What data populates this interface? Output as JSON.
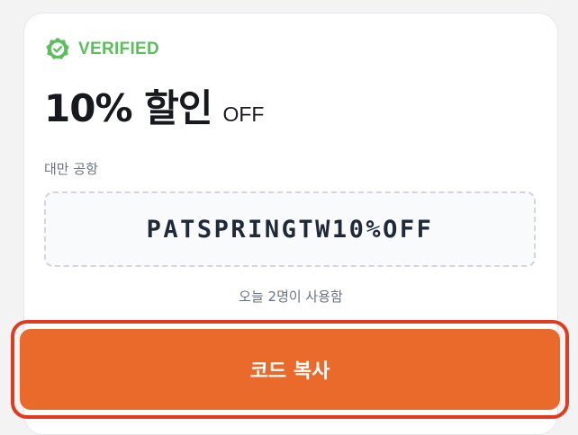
{
  "coupon": {
    "verified_label": "VERIFIED",
    "verified_icon": "verified-badge-icon",
    "title": "10% 할인",
    "title_suffix": "OFF",
    "location": "대만 공항",
    "code": "PATSPRINGTW10%OFF",
    "usage_text": "오늘 2명이 사용함"
  },
  "actions": {
    "copy_label": "코드 복사"
  },
  "colors": {
    "verified_green": "#5bbf5d",
    "title_text": "#17191f",
    "muted_text": "#6b7280",
    "code_text": "#1f2937",
    "button_bg": "#ea6a2c",
    "button_text": "#ffffff",
    "highlight_border": "#e03a20"
  }
}
